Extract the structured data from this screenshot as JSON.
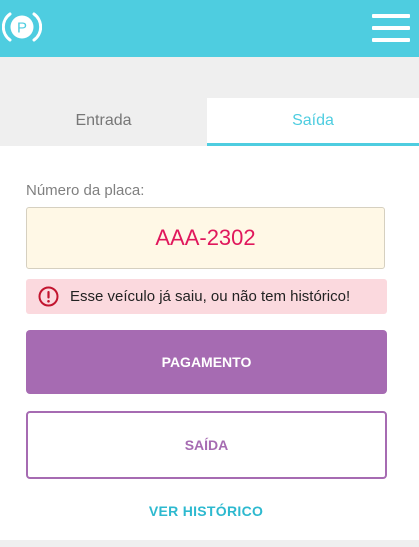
{
  "header": {
    "logo_letter": "P",
    "logo_icon": "parking-logo-icon",
    "menu_icon": "hamburger-menu-icon",
    "background_color": "#4ecde0"
  },
  "tabs": [
    {
      "label": "Entrada",
      "active": false
    },
    {
      "label": "Saída",
      "active": true
    }
  ],
  "form": {
    "plate_label": "Número da placa:",
    "plate_value": "AAA-2302"
  },
  "alert": {
    "icon": "error-circle-icon",
    "message": "Esse veículo já saiu, ou não tem histórico!",
    "background_color": "#fbd9de"
  },
  "actions": {
    "payment_label": "PAGAMENTO",
    "exit_label": "SAÍDA",
    "history_label": "VER HISTÓRICO"
  },
  "colors": {
    "accent": "#4ecde0",
    "purple": "#a66bb2",
    "plate_text": "#e0185c"
  }
}
